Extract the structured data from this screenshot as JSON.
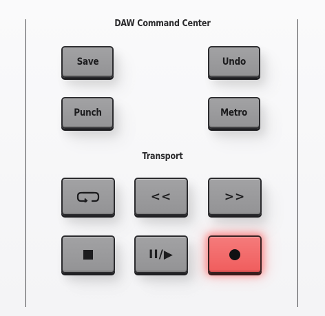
{
  "panel": {
    "title": "DAW Command Center",
    "transport_title": "Transport"
  },
  "buttons": {
    "save": "Save",
    "undo": "Undo",
    "punch": "Punch",
    "metro": "Metro"
  },
  "transport": {
    "rewind": "<<",
    "forward": ">>",
    "play_pause": "II/▶",
    "loop_icon": "loop-icon",
    "stop_icon": "stop-icon",
    "record_icon": "record-icon"
  },
  "colors": {
    "button_gray": "#9b9b9d",
    "record_active": "#f26a6a",
    "border": "#2b2b2e"
  }
}
